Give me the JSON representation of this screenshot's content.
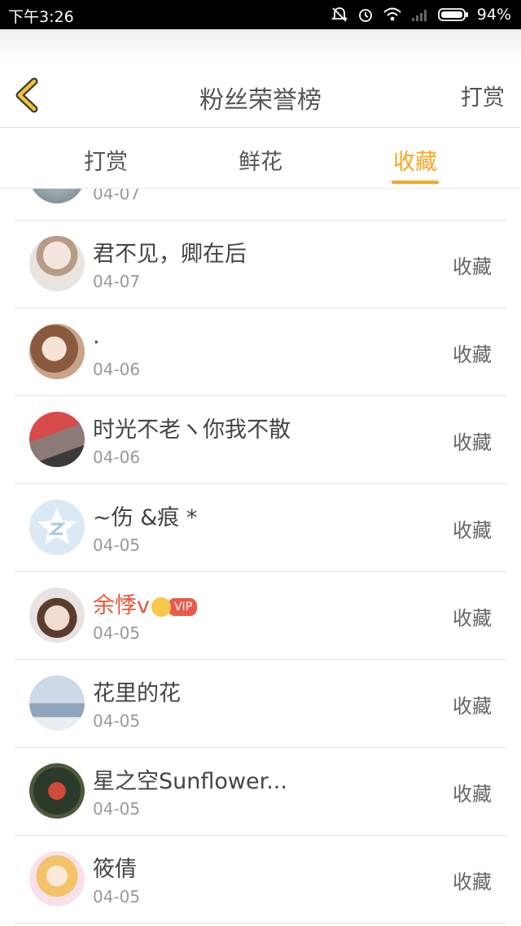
{
  "status_bar": {
    "time": "下午3:26",
    "battery": "94%"
  },
  "header": {
    "title": "粉丝荣誉榜",
    "right_label": "打赏"
  },
  "tabs": [
    {
      "label": "打赏",
      "active": false
    },
    {
      "label": "鲜花",
      "active": false
    },
    {
      "label": "收藏",
      "active": true
    }
  ],
  "colors": {
    "accent": "#f5a623",
    "vip_name": "#e8543a"
  },
  "list": [
    {
      "name": "",
      "date": "04-07",
      "action": ""
    },
    {
      "name": "君不见，卿在后",
      "date": "04-07",
      "action": "收藏"
    },
    {
      "name": ".",
      "date": "04-06",
      "action": "收藏"
    },
    {
      "name": "时光不老ヽ你我不散",
      "date": "04-06",
      "action": "收藏"
    },
    {
      "name": "~伤 &痕 *",
      "date": "04-05",
      "action": "收藏"
    },
    {
      "name": "余悸v",
      "date": "04-05",
      "action": "收藏",
      "vip_label": "VIP"
    },
    {
      "name": "花里的花",
      "date": "04-05",
      "action": "收藏"
    },
    {
      "name": "星之空Sunflower...",
      "date": "04-05",
      "action": "收藏"
    },
    {
      "name": "筱倩",
      "date": "04-05",
      "action": "收藏"
    }
  ]
}
